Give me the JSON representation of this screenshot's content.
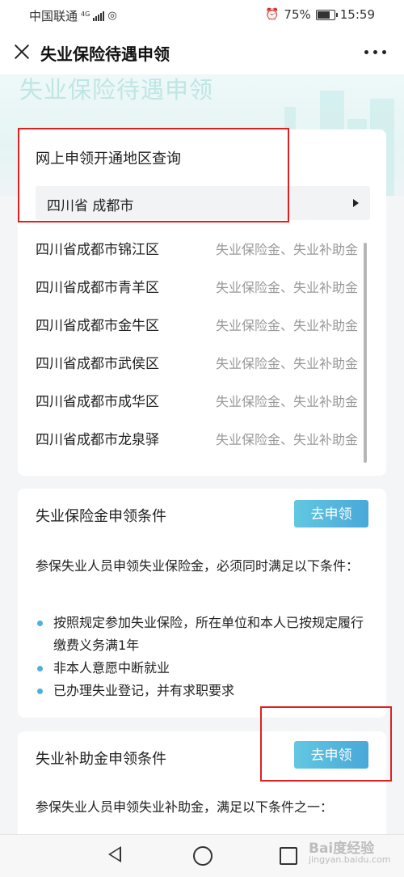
{
  "status_bar": {
    "carrier": "中国联通",
    "network": "4G",
    "battery": "75%",
    "battery_level": 0.75,
    "time": "15:59"
  },
  "header": {
    "title": "失业保险待遇申领",
    "close_icon": "close-icon",
    "more_icon": "more-dots-icon"
  },
  "banner": {
    "title": "失业保险待遇申领"
  },
  "region_query": {
    "title": "网上申领开通地区查询",
    "selected_region": "四川省 成都市",
    "rows": [
      {
        "name": "四川省成都市锦江区",
        "services": "失业保险金、失业补助金"
      },
      {
        "name": "四川省成都市青羊区",
        "services": "失业保险金、失业补助金"
      },
      {
        "name": "四川省成都市金牛区",
        "services": "失业保险金、失业补助金"
      },
      {
        "name": "四川省成都市武侯区",
        "services": "失业保险金、失业补助金"
      },
      {
        "name": "四川省成都市成华区",
        "services": "失业保险金、失业补助金"
      },
      {
        "name": "四川省成都市龙泉驿",
        "services": "失业保险金、失业补助金"
      }
    ]
  },
  "insurance_conditions": {
    "title": "失业保险金申领条件",
    "button": "去申领",
    "intro": "参保失业人员申领失业保险金，必须同时满足以下条件：",
    "bullets": [
      "按照规定参加失业保险，所在单位和本人已按规定履行缴费义务满1年",
      "非本人意愿中断就业",
      "已办理失业登记，并有求职要求"
    ]
  },
  "subsidy_conditions": {
    "title": "失业补助金申领条件",
    "button": "去申领",
    "intro": "参保失业人员申领失业补助金，满足以下条件之一："
  },
  "watermark": {
    "brand": "Bai度经验",
    "url": "jingyan.baidu.com"
  },
  "colors": {
    "accent": "#4bb1df",
    "annotation": "#e02020"
  }
}
